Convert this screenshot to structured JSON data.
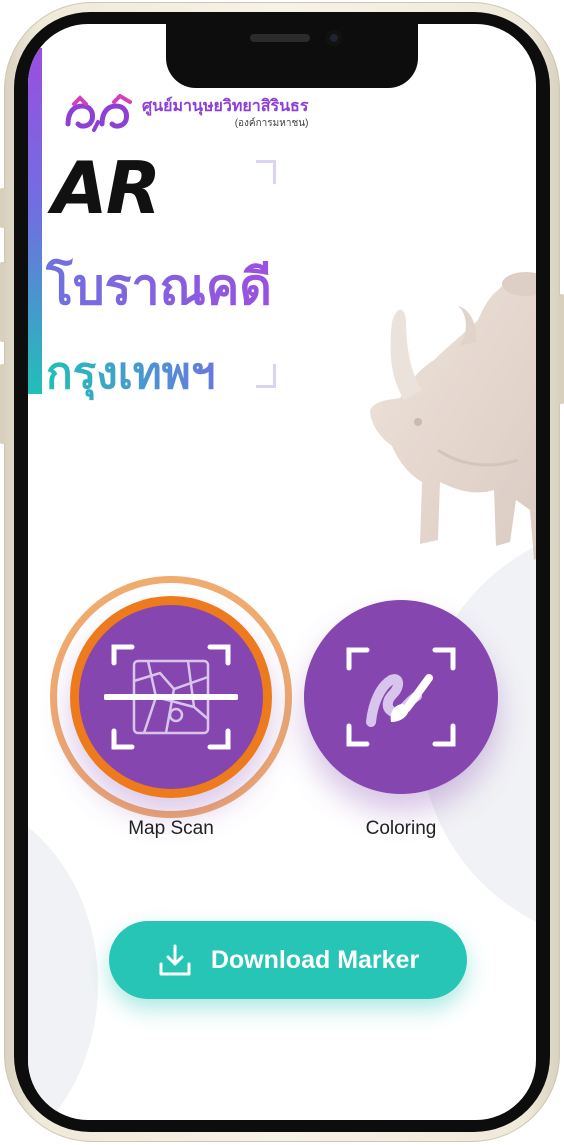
{
  "logo": {
    "name": "ศูนย์มานุษยวิทยาสิรินธร",
    "subtitle": "(องค์การมหาชน)"
  },
  "headline": {
    "title": "AR",
    "line1": "โบราณคดี",
    "line2": "กรุงเทพฯ"
  },
  "actions": [
    {
      "label": "Map Scan",
      "icon": "map-scan-icon",
      "selected": true
    },
    {
      "label": "Coloring",
      "icon": "paintbrush-icon",
      "selected": false
    }
  ],
  "download": {
    "label": "Download Marker",
    "icon": "download-icon"
  },
  "colors": {
    "primary_purple": "#8546B0",
    "selected_ring": "#ED7A1C",
    "download_teal": "#26C5B5",
    "title_gradient_start": "#9A4EE0",
    "title_gradient_end": "#1FC0B8"
  }
}
